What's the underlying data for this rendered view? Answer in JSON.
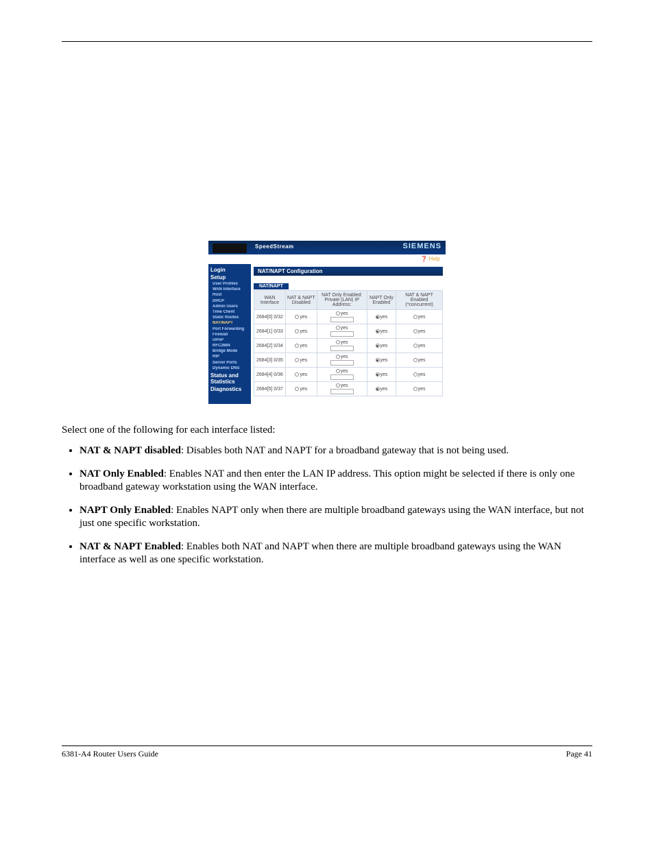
{
  "shot": {
    "brand": "SpeedStream",
    "logo": "SIEMENS",
    "help": "Help",
    "panel_title": "NAT/NAPT Configuration",
    "tab": "NAT/NAPT",
    "sidebar": {
      "login": "Login",
      "setup": "Setup",
      "items": [
        "User Profiles",
        "WAN Interface",
        "Host",
        "DHCP",
        "Admin Users",
        "Time Client",
        "Static Routes",
        "NAT/NAPT",
        "Port Forwarding",
        "Firewall",
        "UPnP",
        "RFC2684",
        "Bridge Mode",
        "RIP",
        "Server Ports",
        "Dynamic DNS"
      ],
      "status": "Status and Statistics",
      "diag": "Diagnostics"
    },
    "hdr": {
      "c0": "WAN Interface",
      "c1": "NAT & NAPT Disabled",
      "c2": "NAT Only Enabled: Private (LAN) IP Address:",
      "c3": "NAPT Only Enabled",
      "c4": "NAT & NAPT Enabled (*concurrent)"
    },
    "rows": [
      {
        "iface": "2684[0] 0/32"
      },
      {
        "iface": "2684[1] 0/33"
      },
      {
        "iface": "2684[2] 0/34"
      },
      {
        "iface": "2684[3] 0/35"
      },
      {
        "iface": "2684[4] 0/36"
      },
      {
        "iface": "2684[5] 0/37"
      }
    ],
    "opt": "yes"
  },
  "lead": "Select one of the following for each interface listed:",
  "bullets": [
    {
      "label": "NAT & NAPT disabled",
      "text": ": Disables both NAT and NAPT for a broadband gateway that is not being used."
    },
    {
      "label": "NAT Only Enabled",
      "text": ": Enables NAT and then enter the LAN IP address. This option might be selected if there is only one broadband gateway workstation using the WAN interface."
    },
    {
      "label": "NAPT Only Enabled",
      "text": ": Enables NAPT only when there are multiple broadband gateways using the WAN interface, but not just one specific workstation. "
    },
    {
      "label": "NAT & NAPT Enabled",
      "text": ": Enables both NAT and NAPT when there are multiple broadband gateways using the WAN interface as well as one specific workstation. "
    }
  ],
  "footer": {
    "left": "6381-A4 Router Users Guide",
    "right": "Page 41"
  }
}
